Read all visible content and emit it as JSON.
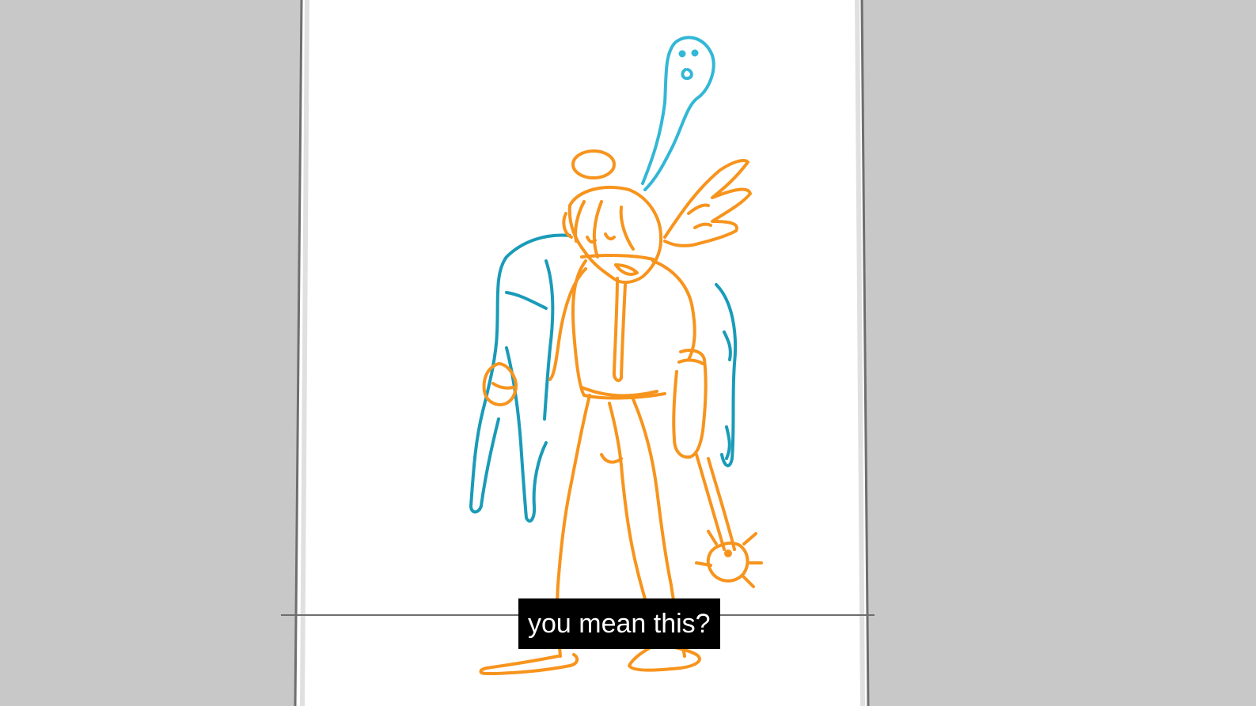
{
  "video": {
    "subtitle": "you mean this?"
  },
  "colors": {
    "background": "#c8c8c8",
    "paper": "#ffffff",
    "guide_line": "#6e6e6e",
    "ink_orange": "#f7941d",
    "ink_blue": "#1a9bb8",
    "ink_light_blue": "#33b7d6",
    "subtitle_bg": "#000000",
    "subtitle_text": "#ffffff"
  }
}
